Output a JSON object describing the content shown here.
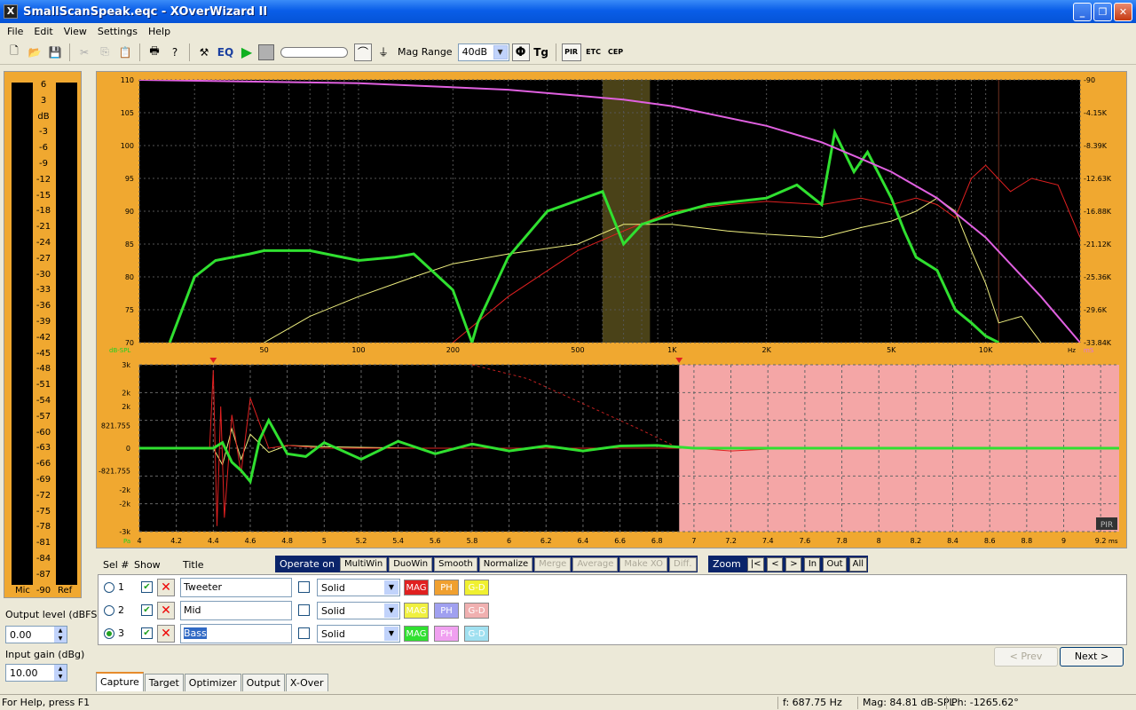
{
  "window": {
    "title": "SmallScanSpeak.eqc - XOverWizard II"
  },
  "menu": [
    "File",
    "Edit",
    "View",
    "Settings",
    "Help"
  ],
  "toolbar": {
    "eq": "EQ",
    "mag_range_label": "Mag Range",
    "mag_range_value": "40dB",
    "phi": "Φ",
    "tg": "Tg",
    "pir": "PIR",
    "etc": "ETC",
    "cep": "CEP"
  },
  "meter": {
    "scale": [
      "6",
      "3",
      "dB",
      "-3",
      "-6",
      "-9",
      "-12",
      "-15",
      "-18",
      "-21",
      "-24",
      "-27",
      "-30",
      "-33",
      "-36",
      "-39",
      "-42",
      "-45",
      "-48",
      "-51",
      "-54",
      "-57",
      "-60",
      "-63",
      "-66",
      "-69",
      "-72",
      "-75",
      "-78",
      "-81",
      "-84",
      "-87",
      "-90"
    ],
    "mic": "Mic",
    "ref": "Ref"
  },
  "output": {
    "label": "Output level (dBFS)",
    "value": "0.00"
  },
  "input": {
    "label": "Input gain (dBg)",
    "value": "10.00"
  },
  "freq_chart": {
    "ylabel": "dB-SPL",
    "yticks": [
      "110",
      "105",
      "100",
      "95",
      "90",
      "85",
      "80",
      "75",
      "70"
    ],
    "yticks_right": [
      "-90",
      "-4.15K",
      "-8.39K",
      "-12.63K",
      "-16.88K",
      "-21.12K",
      "-25.36K",
      "-29.6K",
      "-33.84K"
    ],
    "xticks": [
      "50",
      "100",
      "200",
      "500",
      "1K",
      "2K",
      "5K",
      "10K"
    ],
    "xunit": "Hz",
    "rightunit": "mS"
  },
  "time_chart": {
    "yticks": [
      "3k",
      "2k",
      "2k",
      "821.755",
      "0",
      "-821.755",
      "-2k",
      "-2k",
      "-3k"
    ],
    "xticks": [
      "4",
      "4.2",
      "4.4",
      "4.6",
      "4.8",
      "5",
      "5.2",
      "5.4",
      "5.6",
      "5.8",
      "6",
      "6.2",
      "6.4",
      "6.6",
      "6.8",
      "7",
      "7.2",
      "7.4",
      "7.6",
      "7.8",
      "8",
      "8.2",
      "8.4",
      "8.6",
      "8.8",
      "9",
      "9.2"
    ],
    "xunit": "ms",
    "yunit": "Pa",
    "corner": "PIR"
  },
  "chart_data": [
    {
      "type": "line",
      "xscale": "log",
      "xlim": [
        20,
        20000
      ],
      "ylim": [
        70,
        110
      ],
      "ylabel": "dB-SPL",
      "series": [
        {
          "name": "Tweeter",
          "color": "#e02020",
          "x": [
            200,
            300,
            500,
            700,
            1000,
            1500,
            2000,
            3000,
            4000,
            5000,
            6000,
            7000,
            8000,
            9000,
            10000,
            12000,
            14000,
            17000,
            20000
          ],
          "y": [
            70,
            77,
            84,
            87,
            90,
            91,
            91.5,
            91,
            92,
            91,
            92,
            91,
            89,
            95,
            97,
            93,
            95,
            94,
            86
          ]
        },
        {
          "name": "Mid",
          "color": "#f0f080",
          "x": [
            50,
            70,
            100,
            150,
            200,
            300,
            500,
            700,
            1000,
            1500,
            2000,
            3000,
            4000,
            5000,
            6000,
            7000,
            8000,
            9000,
            10000,
            11000,
            13000,
            15000
          ],
          "y": [
            70,
            74,
            77,
            80,
            82,
            83.5,
            85,
            88,
            88,
            87,
            86.5,
            86,
            87.5,
            88.5,
            90,
            92,
            90,
            84,
            79,
            73,
            74,
            70
          ]
        },
        {
          "name": "Bass",
          "color": "#30e030",
          "x": [
            25,
            30,
            35,
            45,
            50,
            70,
            100,
            130,
            150,
            200,
            230,
            240,
            300,
            400,
            600,
            700,
            800,
            1000,
            1300,
            2000,
            2500,
            3000,
            3300,
            3800,
            4200,
            5000,
            5500,
            6000,
            7000,
            8000,
            9000,
            10000,
            11000
          ],
          "y": [
            70,
            80,
            82.5,
            83.5,
            84,
            84,
            82.5,
            83,
            83.5,
            78,
            70,
            73,
            83,
            90,
            93,
            85,
            88,
            89.5,
            91,
            92,
            94,
            91,
            102,
            96,
            99,
            92,
            87,
            83,
            81,
            75,
            73,
            71,
            70
          ]
        },
        {
          "name": "Target",
          "color": "#e060e0",
          "x": [
            20,
            100,
            300,
            700,
            1000,
            2000,
            3000,
            4000,
            5000,
            7000,
            10000,
            15000,
            20000
          ],
          "y": [
            110,
            109.5,
            108.5,
            107,
            106,
            103,
            100.5,
            98,
            96,
            92,
            86,
            77,
            70
          ]
        }
      ]
    },
    {
      "type": "line",
      "xlim": [
        4,
        9.3
      ],
      "ylim": [
        -3000,
        3000
      ],
      "xlabel": "ms",
      "ylabel": "Pa",
      "series": [
        {
          "name": "Bass",
          "color": "#30e030",
          "x": [
            4,
            4.4,
            4.45,
            4.5,
            4.55,
            4.6,
            4.65,
            4.7,
            4.8,
            4.9,
            5,
            5.2,
            5.4,
            5.6,
            5.8,
            6,
            6.2,
            6.4,
            6.6,
            6.8,
            7,
            7.5,
            8,
            8.5,
            9,
            9.3
          ],
          "y": [
            0,
            0,
            200,
            -500,
            -800,
            -1200,
            300,
            1000,
            -200,
            -300,
            200,
            -400,
            250,
            -200,
            150,
            -100,
            80,
            -100,
            80,
            100,
            0,
            0,
            0,
            0,
            0,
            0
          ]
        },
        {
          "name": "Tweeter",
          "color": "#e02020",
          "x": [
            4,
            4.38,
            4.4,
            4.42,
            4.44,
            4.46,
            4.5,
            4.55,
            4.6,
            4.7,
            4.8,
            5,
            6,
            7,
            7.2,
            7.5,
            8,
            9.3
          ],
          "y": [
            0,
            0,
            2800,
            -2800,
            1500,
            -2500,
            1200,
            -900,
            1800,
            0,
            100,
            0,
            0,
            0,
            -100,
            0,
            0,
            0
          ]
        },
        {
          "name": "Mid",
          "color": "#f0f080",
          "x": [
            4,
            4.4,
            4.45,
            4.5,
            4.55,
            4.6,
            4.7,
            4.8,
            5,
            5.5,
            6,
            9.3
          ],
          "y": [
            0,
            0,
            -600,
            700,
            -400,
            500,
            -150,
            100,
            50,
            0,
            0,
            0
          ]
        }
      ]
    }
  ],
  "ops": {
    "sel": "Sel #",
    "show": "Show",
    "title": "Title",
    "operate": "Operate on",
    "buttons": [
      {
        "label": "MultiWin",
        "dis": false
      },
      {
        "label": "DuoWin",
        "dis": false
      },
      {
        "label": "Smooth",
        "dis": false
      },
      {
        "label": "Normalize",
        "dis": false
      },
      {
        "label": "Merge",
        "dis": true
      },
      {
        "label": "Average",
        "dis": true
      },
      {
        "label": "Make XO",
        "dis": true
      },
      {
        "label": "Diff.",
        "dis": true
      }
    ],
    "zoom": "Zoom",
    "zoom_buttons": [
      "|<",
      "<",
      ">",
      "In",
      "Out",
      "All"
    ]
  },
  "rows": [
    {
      "num": "1",
      "title": "Tweeter",
      "style": "Solid",
      "selected": false,
      "b1": "MAG",
      "b1c": "#e02020",
      "b2": "PH",
      "b2c": "#f0a030",
      "b3": "G-D",
      "b3c": "#f0f030"
    },
    {
      "num": "2",
      "title": "Mid",
      "style": "Solid",
      "selected": false,
      "b1": "MAG",
      "b1c": "#f0f040",
      "b2": "PH",
      "b2c": "#a0a0f0",
      "b3": "G-D",
      "b3c": "#f0b0b0"
    },
    {
      "num": "3",
      "title": "Bass",
      "style": "Solid",
      "selected": true,
      "b1": "MAG",
      "b1c": "#30e030",
      "b2": "PH",
      "b2c": "#f0a0f0",
      "b3": "G-D",
      "b3c": "#a0e0f0"
    }
  ],
  "nav": {
    "prev": "< Prev",
    "next": "Next >"
  },
  "tabs": [
    "Capture",
    "Target",
    "Optimizer",
    "Output",
    "X-Over"
  ],
  "status": {
    "help": "For Help, press F1",
    "freq": "f: 687.75 Hz",
    "mag": "Mag: 84.81 dB-SPL",
    "phase": "Ph: -1265.62°"
  }
}
